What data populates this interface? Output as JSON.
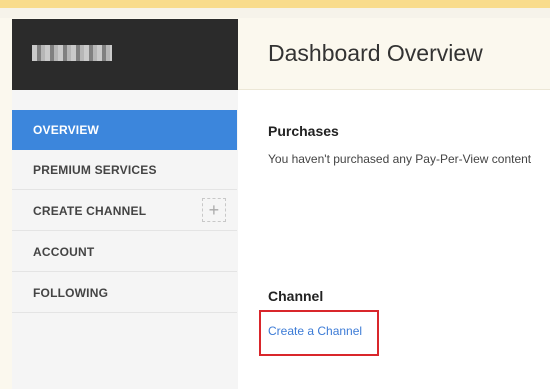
{
  "sidebar": {
    "user_name_obscured": "",
    "items": [
      {
        "label": "OVERVIEW",
        "active": true
      },
      {
        "label": "PREMIUM SERVICES",
        "active": false
      },
      {
        "label": "CREATE CHANNEL",
        "active": false,
        "icon": "plus-icon"
      },
      {
        "label": "ACCOUNT",
        "active": false
      },
      {
        "label": "FOLLOWING",
        "active": false
      }
    ]
  },
  "main": {
    "title": "Dashboard Overview",
    "purchases": {
      "title": "Purchases",
      "text": "You haven't purchased any Pay-Per-View content"
    },
    "channel": {
      "title": "Channel",
      "link": "Create a Channel"
    }
  },
  "colors": {
    "accent_blue": "#3c86dc",
    "highlight_red": "#d9262b",
    "sidebar_dark": "#2b2b2b",
    "top_bar": "#f9dc8c"
  }
}
